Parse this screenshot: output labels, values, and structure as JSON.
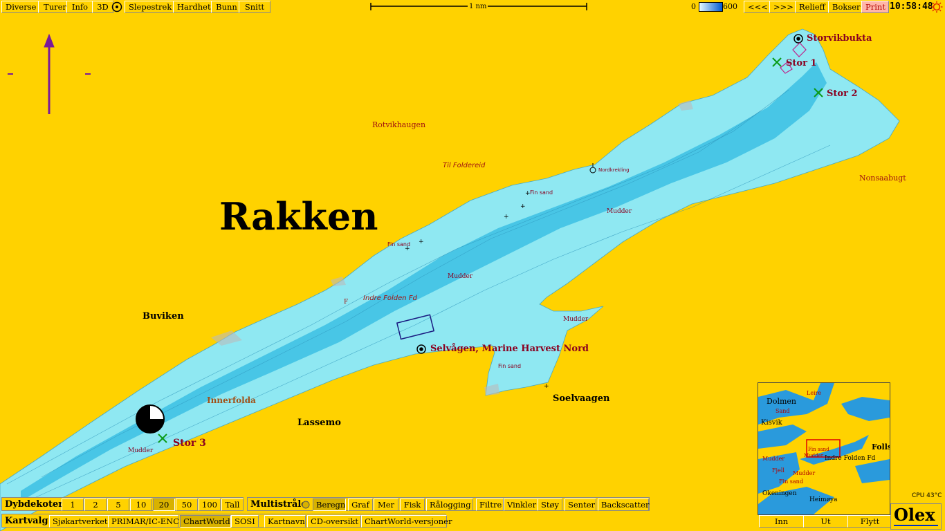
{
  "toolbar": {
    "left_buttons": [
      "Diverse",
      "Turer",
      "Info",
      "3D",
      "Slepestrek",
      "Hardhet",
      "Bunn",
      "Snitt"
    ],
    "scale_label": "1 nm",
    "depth_min": "0",
    "depth_max": "600",
    "right_buttons": [
      "<<<",
      ">>>",
      "Relieff",
      "Bokser",
      "Print"
    ],
    "clock": "10:58:48"
  },
  "map": {
    "title": "Rakken",
    "labels": {
      "storvikbukta": "Storvikbukta",
      "stor1": "Stor 1",
      "stor2": "Stor 2",
      "stor3": "Stor 3",
      "rotvikhaugen": "Rotvikhaugen",
      "til_foldereid": "Til Foldereid",
      "nordkrekling": "Nordkrekling",
      "fin_sand_1": "Fin sand",
      "fin_sand_2": "Fin sand",
      "fin_sand_3": "Fin sand",
      "mudder_1": "Mudder",
      "mudder_2": "Mudder",
      "mudder_3": "Mudder",
      "mudder_4": "Mudder",
      "nonsaabugt": "Nonsaabugt",
      "indre_folden": "Indre Folden Fd",
      "buviken": "Buviken",
      "selvagen": "Selvågen, Marine Harvest Nord",
      "soelvaagen": "Soelvaagen",
      "innerfolda": "Innerfolda",
      "lassemo": "Lassemo",
      "f_mark": "F"
    },
    "colors": {
      "land": "#ffd200",
      "water_shallow": "#8fe8f2",
      "water_deep": "#3cc0e4",
      "marker": "#8a0020"
    }
  },
  "inset": {
    "labels": [
      "Dolmen",
      "Kisvik",
      "Leire",
      "Fin sand",
      "Mudder",
      "Indre Folden Fd",
      "Fjell",
      "Mudder",
      "Fin sand",
      "Mudder",
      "Okeningen",
      "Heimøya",
      "Folls",
      "Sand"
    ],
    "buttons": [
      "Inn",
      "Ut",
      "Flytt"
    ]
  },
  "status": {
    "cpu": "CPU 43°C",
    "logo": "Olex"
  },
  "bottom": {
    "dybdekoter": {
      "title": "Dybdekoter",
      "options": [
        "1",
        "2",
        "5",
        "10",
        "20",
        "50",
        "100",
        "Tall"
      ],
      "selected": "20"
    },
    "multistrale": {
      "title": "Multistråle",
      "buttons": [
        "Beregn",
        "Graf",
        "Mer",
        "Fisk",
        "Rålogging",
        "Filtre",
        "Vinkler",
        "Støy",
        "Senter",
        "Backscatter"
      ]
    },
    "kartvalg": {
      "title": "Kartvalg",
      "buttons": [
        "Sjøkartverket",
        "PRIMAR/IC-ENC",
        "ChartWorld",
        "SOSI",
        "Kartnavn",
        "CD-oversikt",
        "ChartWorld-versjoner"
      ],
      "selected": "ChartWorld"
    }
  }
}
